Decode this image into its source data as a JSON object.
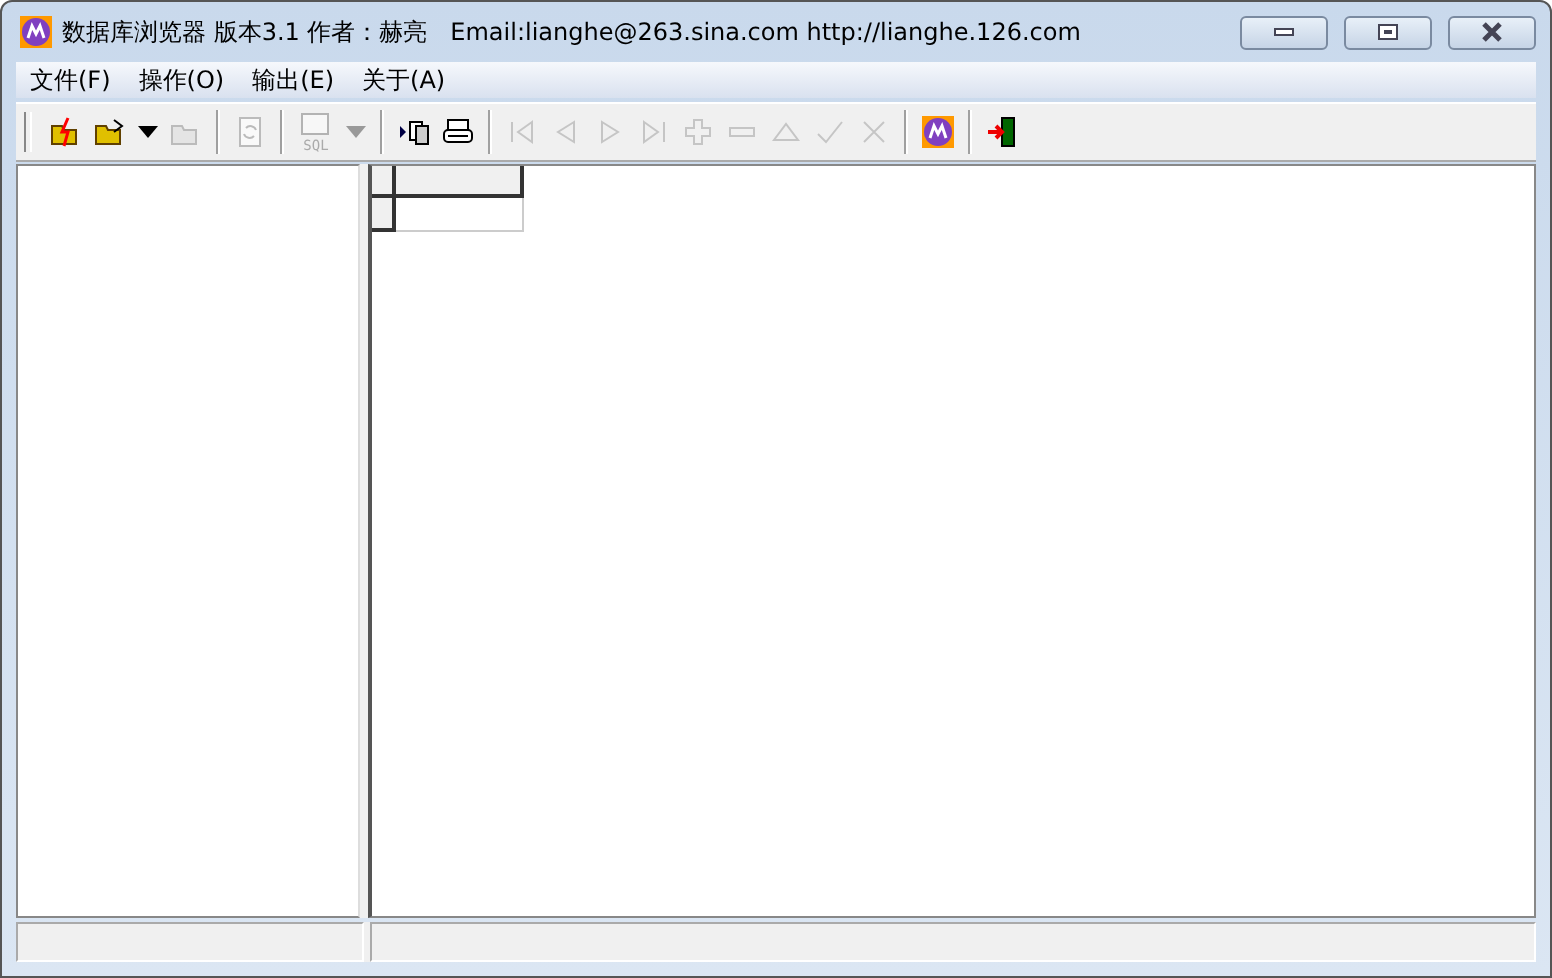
{
  "window": {
    "title": "数据库浏览器 版本3.1 作者：赫亮   Email:lianghe@263.sina.com http://lianghe.126.com"
  },
  "menu": [
    {
      "label": "文件(F)"
    },
    {
      "label": "操作(O)"
    },
    {
      "label": "输出(E)"
    },
    {
      "label": "关于(A)"
    }
  ],
  "toolbar": [
    {
      "kind": "button",
      "disabled": false
    },
    {
      "kind": "button",
      "disabled": false
    },
    {
      "kind": "dropdown",
      "disabled": false
    },
    {
      "kind": "button",
      "disabled": true
    },
    {
      "kind": "separator"
    },
    {
      "kind": "button",
      "disabled": true
    },
    {
      "kind": "separator"
    },
    {
      "kind": "sql",
      "label": "SQL",
      "disabled": true
    },
    {
      "kind": "dropdown",
      "disabled": true
    },
    {
      "kind": "separator"
    },
    {
      "kind": "button",
      "disabled": false
    },
    {
      "kind": "button",
      "disabled": false
    },
    {
      "kind": "separator"
    },
    {
      "kind": "button",
      "disabled": true
    },
    {
      "kind": "button",
      "disabled": true
    },
    {
      "kind": "button",
      "disabled": true
    },
    {
      "kind": "button",
      "disabled": true
    },
    {
      "kind": "button",
      "disabled": true
    },
    {
      "kind": "button",
      "disabled": true
    },
    {
      "kind": "button",
      "disabled": true
    },
    {
      "kind": "button",
      "disabled": true
    },
    {
      "kind": "button",
      "disabled": true
    },
    {
      "kind": "separator"
    },
    {
      "kind": "button",
      "disabled": false
    },
    {
      "kind": "separator"
    },
    {
      "kind": "button",
      "disabled": false
    }
  ]
}
